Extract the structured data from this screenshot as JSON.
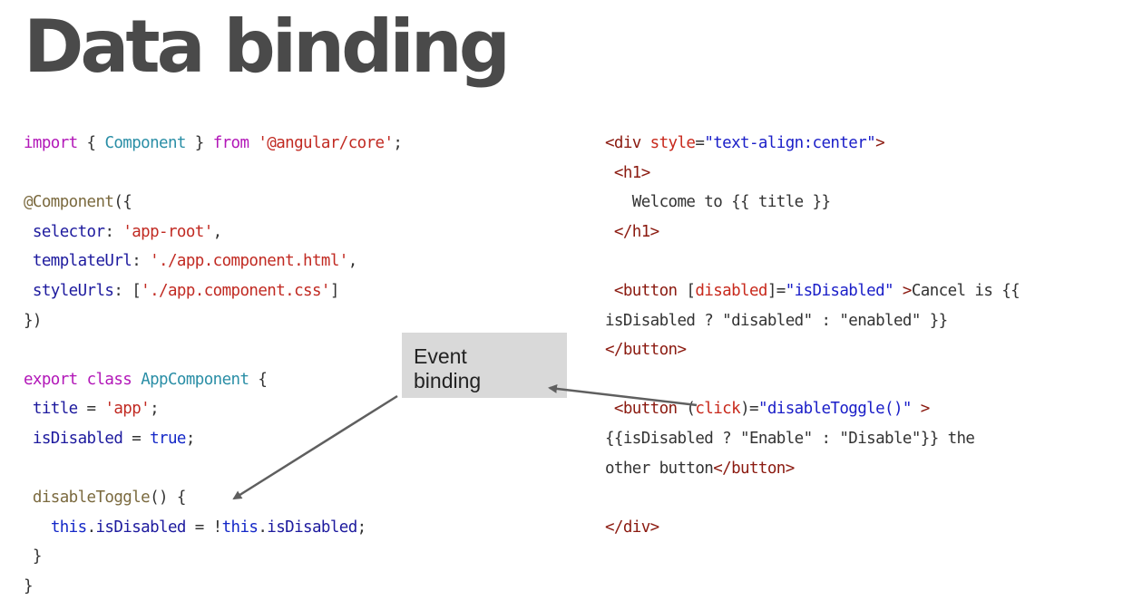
{
  "slide": {
    "title": "Data binding"
  },
  "callout": {
    "line1": "Event",
    "line2": "binding"
  },
  "left_code": [
    [
      {
        "t": "import",
        "c": "kw"
      },
      {
        "t": " { ",
        "c": "plain"
      },
      {
        "t": "Component",
        "c": "type"
      },
      {
        "t": " } ",
        "c": "plain"
      },
      {
        "t": "from",
        "c": "kw"
      },
      {
        "t": " ",
        "c": "plain"
      },
      {
        "t": "'@angular/core'",
        "c": "str"
      },
      {
        "t": ";",
        "c": "plain"
      }
    ],
    [],
    [
      {
        "t": "@Component",
        "c": "deco"
      },
      {
        "t": "({",
        "c": "plain"
      }
    ],
    [
      {
        "t": " selector",
        "c": "prop"
      },
      {
        "t": ": ",
        "c": "plain"
      },
      {
        "t": "'app-root'",
        "c": "str"
      },
      {
        "t": ",",
        "c": "plain"
      }
    ],
    [
      {
        "t": " templateUrl",
        "c": "prop"
      },
      {
        "t": ": ",
        "c": "plain"
      },
      {
        "t": "'./app.component.html'",
        "c": "str"
      },
      {
        "t": ",",
        "c": "plain"
      }
    ],
    [
      {
        "t": " styleUrls",
        "c": "prop"
      },
      {
        "t": ": [",
        "c": "plain"
      },
      {
        "t": "'./app.component.css'",
        "c": "str"
      },
      {
        "t": "]",
        "c": "plain"
      }
    ],
    [
      {
        "t": "})",
        "c": "plain"
      }
    ],
    [],
    [
      {
        "t": "export",
        "c": "kw"
      },
      {
        "t": " ",
        "c": "plain"
      },
      {
        "t": "class",
        "c": "kw"
      },
      {
        "t": " ",
        "c": "plain"
      },
      {
        "t": "AppComponent",
        "c": "type"
      },
      {
        "t": " {",
        "c": "plain"
      }
    ],
    [
      {
        "t": " title",
        "c": "prop"
      },
      {
        "t": " = ",
        "c": "plain"
      },
      {
        "t": "'app'",
        "c": "str"
      },
      {
        "t": ";",
        "c": "plain"
      }
    ],
    [
      {
        "t": " isDisabled",
        "c": "prop"
      },
      {
        "t": " = ",
        "c": "plain"
      },
      {
        "t": "true",
        "c": "bool"
      },
      {
        "t": ";",
        "c": "plain"
      }
    ],
    [],
    [
      {
        "t": " disableToggle",
        "c": "deco"
      },
      {
        "t": "() {",
        "c": "plain"
      }
    ],
    [
      {
        "t": "   ",
        "c": "plain"
      },
      {
        "t": "this",
        "c": "bool"
      },
      {
        "t": ".",
        "c": "plain"
      },
      {
        "t": "isDisabled",
        "c": "prop"
      },
      {
        "t": " = !",
        "c": "plain"
      },
      {
        "t": "this",
        "c": "bool"
      },
      {
        "t": ".",
        "c": "plain"
      },
      {
        "t": "isDisabled",
        "c": "prop"
      },
      {
        "t": ";",
        "c": "plain"
      }
    ],
    [
      {
        "t": " }",
        "c": "plain"
      }
    ],
    [
      {
        "t": "}",
        "c": "plain"
      }
    ]
  ],
  "right_code": [
    [
      {
        "t": "<div",
        "c": "tag"
      },
      {
        "t": " style",
        "c": "attr"
      },
      {
        "t": "=",
        "c": "plain"
      },
      {
        "t": "\"text-align:center\"",
        "c": "aval"
      },
      {
        "t": ">",
        "c": "tag"
      }
    ],
    [
      {
        "t": " <h1>",
        "c": "tag"
      }
    ],
    [
      {
        "t": "   Welcome to {{ title }}",
        "c": "plain"
      }
    ],
    [
      {
        "t": " </h1>",
        "c": "tag"
      }
    ],
    [],
    [
      {
        "t": " <button",
        "c": "tag"
      },
      {
        "t": " [",
        "c": "plain"
      },
      {
        "t": "disabled",
        "c": "attr"
      },
      {
        "t": "]=",
        "c": "plain"
      },
      {
        "t": "\"isDisabled\"",
        "c": "aval"
      },
      {
        "t": " >",
        "c": "tag"
      },
      {
        "t": "Cancel is {{",
        "c": "plain"
      }
    ],
    [
      {
        "t": "isDisabled ? \"disabled\" : \"enabled\" }}",
        "c": "plain"
      }
    ],
    [
      {
        "t": "</button>",
        "c": "tag"
      }
    ],
    [],
    [
      {
        "t": " <button",
        "c": "tag"
      },
      {
        "t": " (",
        "c": "plain"
      },
      {
        "t": "click",
        "c": "attr"
      },
      {
        "t": ")=",
        "c": "plain"
      },
      {
        "t": "\"disableToggle()\"",
        "c": "aval"
      },
      {
        "t": " >",
        "c": "tag"
      }
    ],
    [
      {
        "t": "{{isDisabled ? \"Enable\" : \"Disable\"}} the",
        "c": "plain"
      }
    ],
    [
      {
        "t": "other button",
        "c": "plain"
      },
      {
        "t": "</button>",
        "c": "tag"
      }
    ],
    [],
    [
      {
        "t": "</div>",
        "c": "tag"
      }
    ]
  ]
}
